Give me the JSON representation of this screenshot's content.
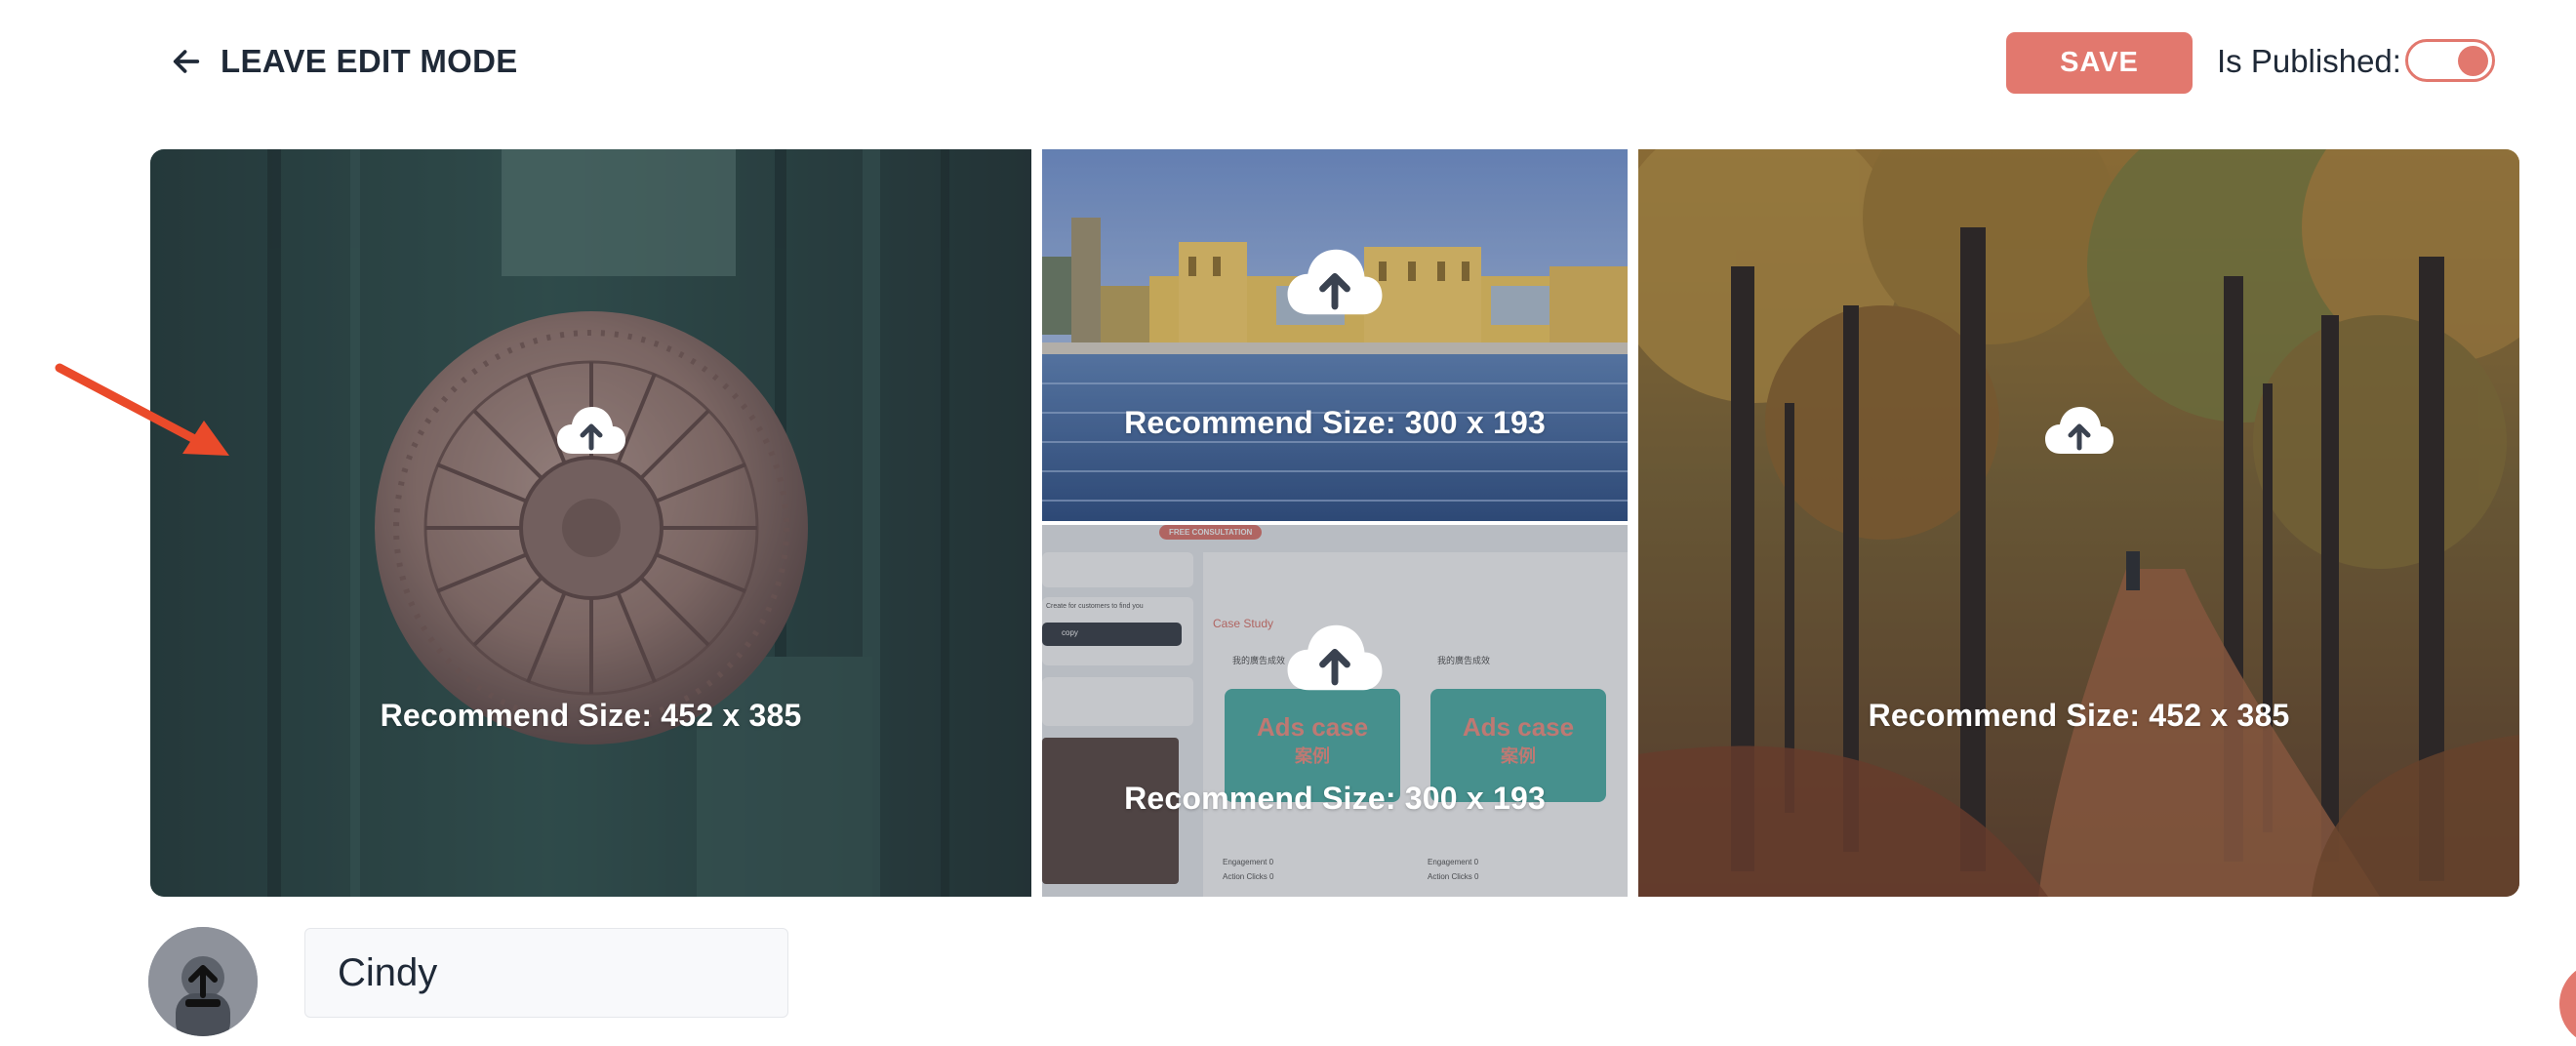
{
  "header": {
    "leave_label": "LEAVE EDIT MODE",
    "save_label": "SAVE",
    "published_label": "Is Published:",
    "is_published": true
  },
  "banner": {
    "tiles": [
      {
        "label": "Recommend Size: 452 x 385",
        "icon": "cloud-upload-icon",
        "scene": "door knob"
      },
      {
        "label": "Recommend Size: 300 x 193",
        "icon": "cloud-upload-icon",
        "scene": "waterfront building"
      },
      {
        "label": "Recommend Size: 300 x 193",
        "icon": "cloud-upload-icon",
        "scene": "app screenshot"
      },
      {
        "label": "Recommend Size: 452 x 385",
        "icon": "cloud-upload-icon",
        "scene": "autumn forest path"
      }
    ],
    "thumb": {
      "consult_label": "FREE CONSULTATION",
      "case_study_label": "Case Study",
      "copy_label": "copy",
      "customers_text": "Create for customers to find you",
      "ads_text": "Ads case",
      "ads_cjk": "案例",
      "col_header": "我的廣告成效",
      "engagement": "Engagement 0",
      "action_clicks": "Action Clicks 0"
    }
  },
  "profile": {
    "name_value": "Cindy",
    "avatar_icon": "upload-icon"
  },
  "colors": {
    "accent": "#e2786e",
    "text": "#1f2937",
    "annotation": "#ea4a2a"
  }
}
